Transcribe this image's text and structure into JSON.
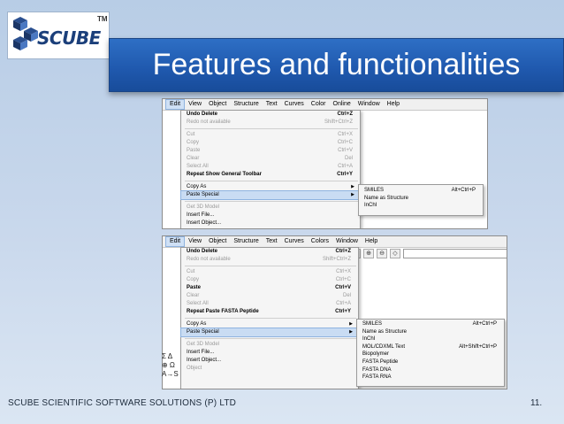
{
  "logo": {
    "text": "SCUBE",
    "tm": "TM"
  },
  "slide": {
    "title": "Features and functionalities",
    "footer": "SCUBE SCIENTIFIC SOFTWARE SOLUTIONS (P) LTD",
    "page_number": "11."
  },
  "screenshot1": {
    "menubar": [
      "Edit",
      "View",
      "Object",
      "Structure",
      "Text",
      "Curves",
      "Color",
      "Online",
      "Window",
      "Help"
    ],
    "edit_menu": [
      {
        "label": "Undo Delete",
        "shortcut": "Ctrl+Z",
        "state": "bold"
      },
      {
        "label": "Redo not available",
        "shortcut": "Shift+Ctrl+Z",
        "state": "disabled"
      },
      {
        "separator": true
      },
      {
        "label": "Cut",
        "shortcut": "Ctrl+X",
        "state": "disabled"
      },
      {
        "label": "Copy",
        "shortcut": "Ctrl+C",
        "state": "disabled"
      },
      {
        "label": "Paste",
        "shortcut": "Ctrl+V",
        "state": "disabled"
      },
      {
        "label": "Clear",
        "shortcut": "Del",
        "state": "disabled"
      },
      {
        "label": "Select All",
        "shortcut": "Ctrl+A",
        "state": "disabled"
      },
      {
        "label": "Repeat Show General Toolbar",
        "shortcut": "Ctrl+Y",
        "state": "bold"
      },
      {
        "separator": true
      },
      {
        "label": "Copy As",
        "submenu": true,
        "state": "normal"
      },
      {
        "label": "Paste Special",
        "submenu": true,
        "state": "highlighted"
      },
      {
        "separator": true
      },
      {
        "label": "Get 3D Model",
        "state": "disabled"
      },
      {
        "label": "Insert File...",
        "state": "normal"
      },
      {
        "label": "Insert Object...",
        "state": "normal"
      },
      {
        "label": "Object",
        "state": "disabled"
      }
    ],
    "paste_special_menu": [
      {
        "label": "SMILES",
        "shortcut": "Alt+Ctrl+P"
      },
      {
        "label": "Name as Structure",
        "shortcut": ""
      },
      {
        "label": "InChI",
        "shortcut": ""
      }
    ]
  },
  "screenshot2": {
    "menubar": [
      "Edit",
      "View",
      "Object",
      "Structure",
      "Text",
      "Curves",
      "Colors",
      "Window",
      "Help"
    ],
    "edit_menu": [
      {
        "label": "Undo Delete",
        "shortcut": "Ctrl+Z",
        "state": "bold"
      },
      {
        "label": "Redo not available",
        "shortcut": "Shift+Ctrl+Z",
        "state": "disabled"
      },
      {
        "separator": true
      },
      {
        "label": "Cut",
        "shortcut": "Ctrl+X",
        "state": "disabled"
      },
      {
        "label": "Copy",
        "shortcut": "Ctrl+C",
        "state": "disabled"
      },
      {
        "label": "Paste",
        "shortcut": "Ctrl+V",
        "state": "bold"
      },
      {
        "label": "Clear",
        "shortcut": "Del",
        "state": "disabled"
      },
      {
        "label": "Select All",
        "shortcut": "Ctrl+A",
        "state": "disabled"
      },
      {
        "label": "Repeat Paste FASTA Peptide",
        "shortcut": "Ctrl+Y",
        "state": "bold"
      },
      {
        "separator": true
      },
      {
        "label": "Copy As",
        "submenu": true,
        "state": "normal"
      },
      {
        "label": "Paste Special",
        "submenu": true,
        "state": "highlighted"
      },
      {
        "separator": true
      },
      {
        "label": "Get 3D Model",
        "state": "disabled"
      },
      {
        "label": "Insert File...",
        "state": "normal"
      },
      {
        "label": "Insert Object...",
        "state": "normal"
      },
      {
        "label": "Object",
        "state": "disabled"
      }
    ],
    "paste_special_menu": [
      {
        "label": "SMILES",
        "shortcut": "Alt+Ctrl+P"
      },
      {
        "label": "Name as Structure",
        "shortcut": ""
      },
      {
        "label": "InChI",
        "shortcut": ""
      },
      {
        "label": "MOL/CDXML Text",
        "shortcut": "Alt+Shift+Ctrl+P"
      },
      {
        "label": "Biopolymer",
        "shortcut": ""
      },
      {
        "label": "FASTA Peptide",
        "shortcut": ""
      },
      {
        "label": "FASTA DNA",
        "shortcut": ""
      },
      {
        "label": "FASTA RNA",
        "shortcut": ""
      }
    ],
    "left_toolbar": [
      "Σ Δ",
      "⊕ Ω",
      "A→S"
    ]
  },
  "colors": {
    "title_banner": "#1f58ad",
    "menu_highlight": "#c9dcf3",
    "disabled_text": "#9a9a9a"
  }
}
